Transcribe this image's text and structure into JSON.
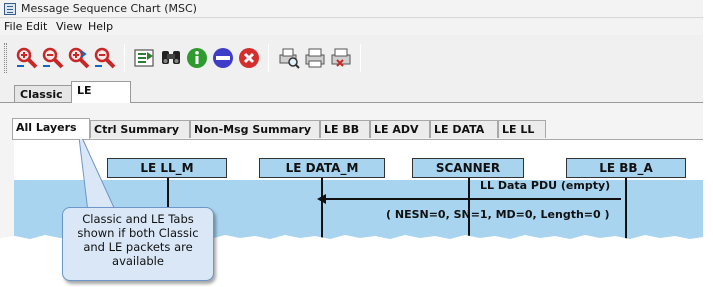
{
  "window": {
    "title": "Message Sequence Chart (MSC)",
    "icon": "msc-app-icon"
  },
  "menu": {
    "items": [
      "File",
      "Edit",
      "View",
      "Help"
    ]
  },
  "toolbar": {
    "buttons": [
      {
        "name": "zoom-in-icon",
        "color": "#c62828"
      },
      {
        "name": "zoom-out-icon",
        "color": "#c62828"
      },
      {
        "name": "zoom-in-horizontal-icon",
        "color": "#c62828"
      },
      {
        "name": "zoom-out-horizontal-icon",
        "color": "#c62828"
      },
      {
        "name": "goto-icon",
        "color": "#2e7d32"
      },
      {
        "name": "find-icon",
        "color": "#333333"
      },
      {
        "name": "info-icon",
        "color": "#2e9b2e"
      },
      {
        "name": "stop-icon",
        "color": "#3d3dc8"
      },
      {
        "name": "cancel-icon",
        "color": "#d32f2f"
      },
      {
        "name": "print-preview-icon",
        "color": "#555555"
      },
      {
        "name": "print-icon",
        "color": "#555555"
      },
      {
        "name": "print-setup-icon",
        "color": "#555555"
      }
    ]
  },
  "outer_tabs": [
    {
      "label": "Classic"
    },
    {
      "label": "LE"
    }
  ],
  "inner_tabs": [
    {
      "label": "All Layers"
    },
    {
      "label": "Ctrl Summary"
    },
    {
      "label": "Non-Msg Summary"
    },
    {
      "label": "LE BB"
    },
    {
      "label": "LE ADV"
    },
    {
      "label": "LE DATA"
    },
    {
      "label": "LE LL"
    }
  ],
  "chart": {
    "lifelines": [
      "LE LL_M",
      "LE DATA_M",
      "SCANNER",
      "LE BB_A"
    ],
    "message": {
      "label": "LL Data PDU (empty)",
      "params": "( NESN=0, SN=1, MD=0, Length=0 )"
    },
    "band_color": "#a8d4f0"
  },
  "callout": {
    "text": [
      "Classic and LE Tabs",
      "shown if both Classic",
      "and LE packets are",
      "available"
    ]
  }
}
